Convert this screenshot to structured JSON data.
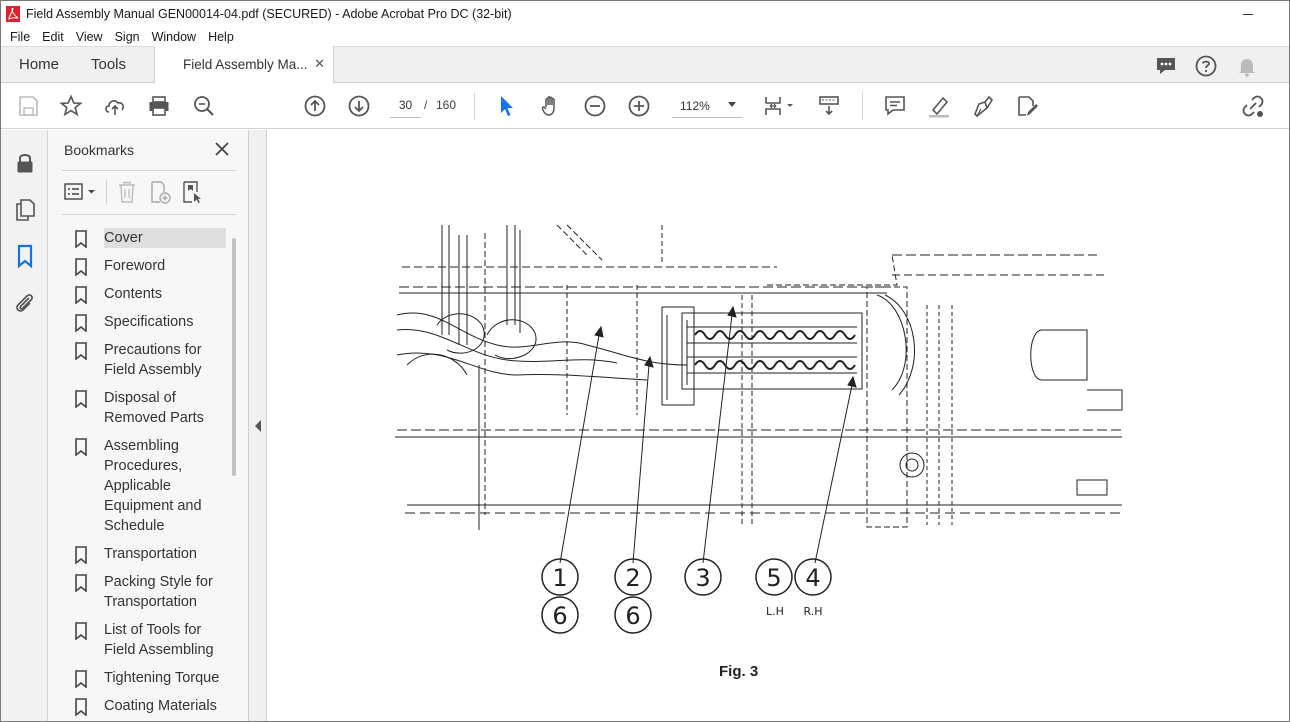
{
  "window": {
    "title": "Field Assembly Manual GEN00014-04.pdf (SECURED) - Adobe Acrobat Pro DC (32-bit)",
    "app_icon": "acrobat-logo-icon",
    "minimize_icon": "minimize-icon"
  },
  "menu": [
    "File",
    "Edit",
    "View",
    "Sign",
    "Window",
    "Help"
  ],
  "tabs": {
    "home": "Home",
    "tools": "Tools",
    "document": "Field Assembly Ma...",
    "close_icon": "close-icon",
    "right_icons": [
      "comment-bubble-icon",
      "help-icon",
      "notifications-bell-icon"
    ]
  },
  "toolbar": {
    "page_current": "30",
    "page_separator": "/",
    "page_total": "160",
    "zoom": "112%",
    "icons": [
      "save-icon",
      "bookmark-star-icon",
      "upload-cloud-icon",
      "print-icon",
      "zoom-search-icon",
      "previous-page-icon",
      "next-page-icon",
      "select-cursor-icon",
      "hand-tool-icon",
      "zoom-out-icon",
      "zoom-in-icon",
      "page-fit-icon",
      "scroll-mode-icon",
      "add-comment-icon",
      "highlight-icon",
      "draw-sign-icon",
      "edit-fill-icon",
      "share-link-icon"
    ]
  },
  "rail": {
    "icons": [
      "lock-icon",
      "pages-icon",
      "bookmarks-icon",
      "attachments-icon"
    ]
  },
  "bookmarks_panel": {
    "title": "Bookmarks",
    "close_icon": "close-panel-icon",
    "tool_icons": [
      "options-menu-icon",
      "delete-bookmark-icon",
      "new-bookmark-icon",
      "expand-bookmark-icon"
    ],
    "items": [
      {
        "label": "Cover",
        "selected": true
      },
      {
        "label": "Foreword",
        "selected": false
      },
      {
        "label": "Contents",
        "selected": false
      },
      {
        "label": "Specifications",
        "selected": false
      },
      {
        "label": "Precautions for Field Assembly",
        "selected": false
      },
      {
        "label": "Disposal of Removed Parts",
        "selected": false
      },
      {
        "label": "Assembling Procedures, Applicable Equipment and Schedule",
        "selected": false
      },
      {
        "label": "Transportation",
        "selected": false
      },
      {
        "label": "Packing Style for Transportation",
        "selected": false
      },
      {
        "label": "List of Tools for Field Assembling",
        "selected": false
      },
      {
        "label": "Tightening Torque",
        "selected": false
      },
      {
        "label": "Coating Materials",
        "selected": false
      }
    ]
  },
  "document": {
    "figure_caption": "Fig. 3",
    "callouts": [
      "1",
      "6",
      "2",
      "6",
      "3",
      "5",
      "4"
    ],
    "callout_labels": [
      "L.H",
      "R.H"
    ]
  },
  "colors": {
    "accent_blue": "#1473e6",
    "acrobat_red": "#d9232e",
    "icon_gray": "#5a5a5a"
  }
}
